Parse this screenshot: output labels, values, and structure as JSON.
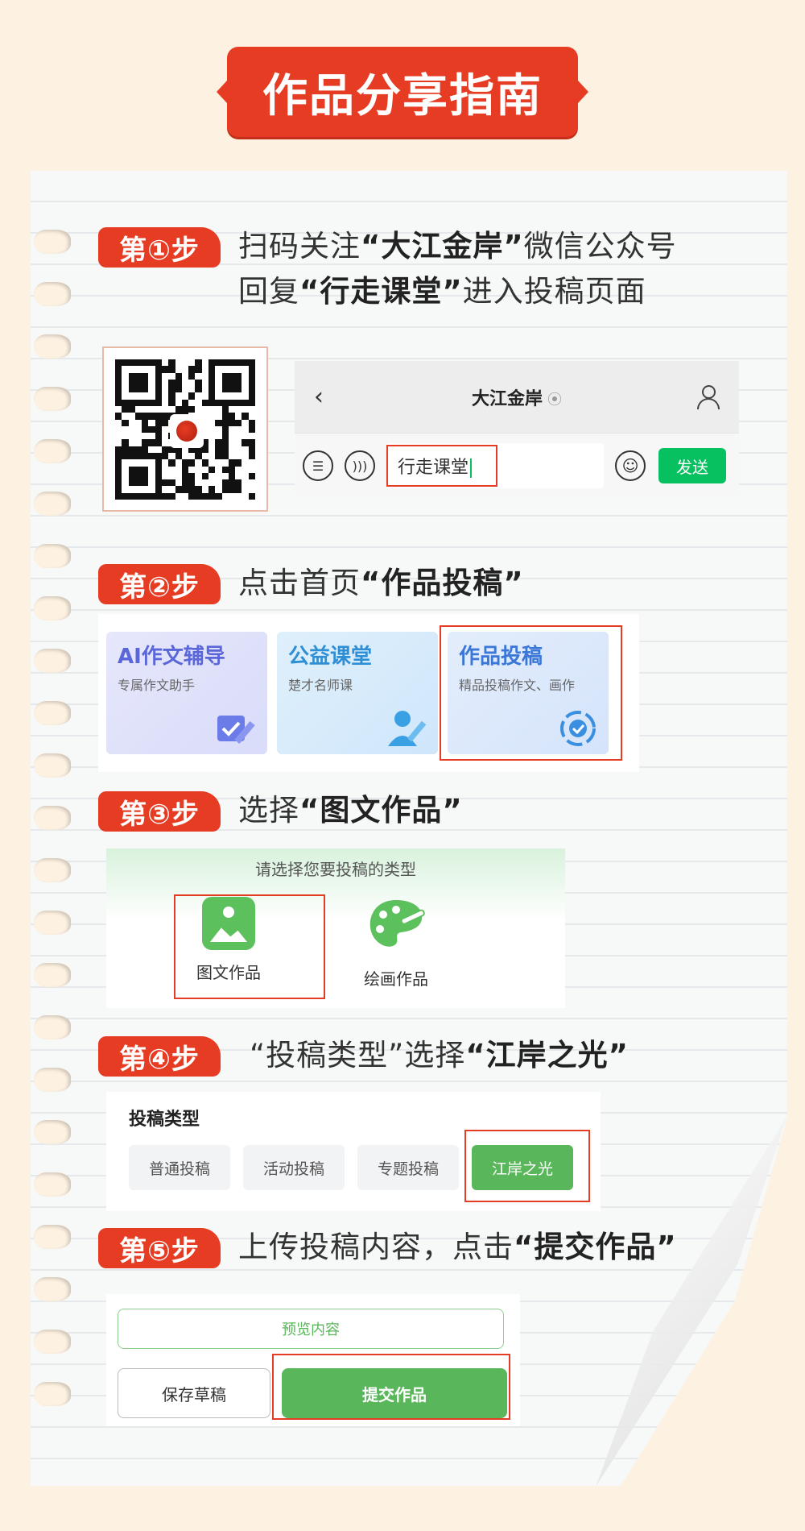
{
  "title": "作品分享指南",
  "steps": [
    {
      "badge": "第①步",
      "line1_pre": "扫码关注",
      "line1_bold": "“大江金岸”",
      "line1_post": "微信公众号",
      "line2_pre": "回复",
      "line2_bold": "“行走课堂”",
      "line2_post": "进入投稿页面"
    },
    {
      "badge": "第②步",
      "pre": "点击首页",
      "bold": "“作品投稿”"
    },
    {
      "badge": "第③步",
      "pre": "选择",
      "bold": "“图文作品”"
    },
    {
      "badge": "第④步",
      "pre": "“投稿类型”选择",
      "bold": "“江岸之光”"
    },
    {
      "badge": "第⑤步",
      "pre": "上传投稿内容，点击",
      "bold": "“提交作品”"
    }
  ],
  "chat": {
    "back": "‹",
    "title": "大江金岸",
    "input_text": "行走课堂",
    "send": "发送"
  },
  "features": [
    {
      "title": "AI作文辅导",
      "sub": "专属作文助手",
      "icon": "pencil-check-icon"
    },
    {
      "title": "公益课堂",
      "sub": "楚才名师课",
      "icon": "teacher-icon"
    },
    {
      "title": "作品投稿",
      "sub": "精品投稿作文、画作",
      "icon": "submit-cycle-icon"
    }
  ],
  "type_select": {
    "prompt": "请选择您要投稿的类型",
    "options": [
      {
        "label": "图文作品",
        "icon": "image-icon"
      },
      {
        "label": "绘画作品",
        "icon": "palette-icon"
      }
    ]
  },
  "category": {
    "title": "投稿类型",
    "chips": [
      "普通投稿",
      "活动投稿",
      "专题投稿",
      "江岸之光"
    ],
    "active": "江岸之光"
  },
  "actions": {
    "preview": "预览内容",
    "draft": "保存草稿",
    "submit": "提交作品"
  },
  "colors": {
    "accent": "#e63c23",
    "wechat_green": "#07c160",
    "app_green": "#5ab65a",
    "background": "#fdf1e1"
  }
}
